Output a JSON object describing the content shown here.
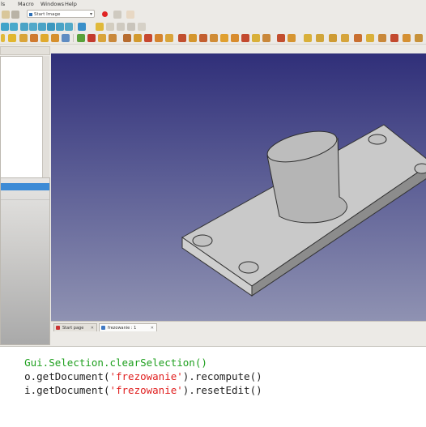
{
  "menubar": {
    "items": [
      "ls",
      "Macro",
      "Windows",
      "Help"
    ]
  },
  "toolbar": {
    "workbench_label": "Start Image"
  },
  "tabs": [
    {
      "label": "Start page"
    },
    {
      "label": "frezowanie : 1"
    }
  ],
  "console": {
    "lines": [
      [
        {
          "text": "Gui.Selection.clearSelection()",
          "color": "green"
        }
      ],
      [
        {
          "text": "o.getDocument(",
          "color": "black"
        },
        {
          "text": "'frezowanie'",
          "color": "red"
        },
        {
          "text": ").recompute()",
          "color": "black"
        }
      ],
      [
        {
          "text": "i.getDocument(",
          "color": "black"
        },
        {
          "text": "'frezowanie'",
          "color": "red"
        },
        {
          "text": ").resetEdit()",
          "color": "black"
        }
      ]
    ]
  },
  "colors": {
    "selection": "#3c8bd6",
    "view_top": "#302f79",
    "view_bottom": "#8f92b2"
  },
  "icons": [
    "document-icon",
    "workbench-icon",
    "record-macro-icon",
    "view-axo-icon",
    "part-box-icon",
    "close-icon"
  ]
}
